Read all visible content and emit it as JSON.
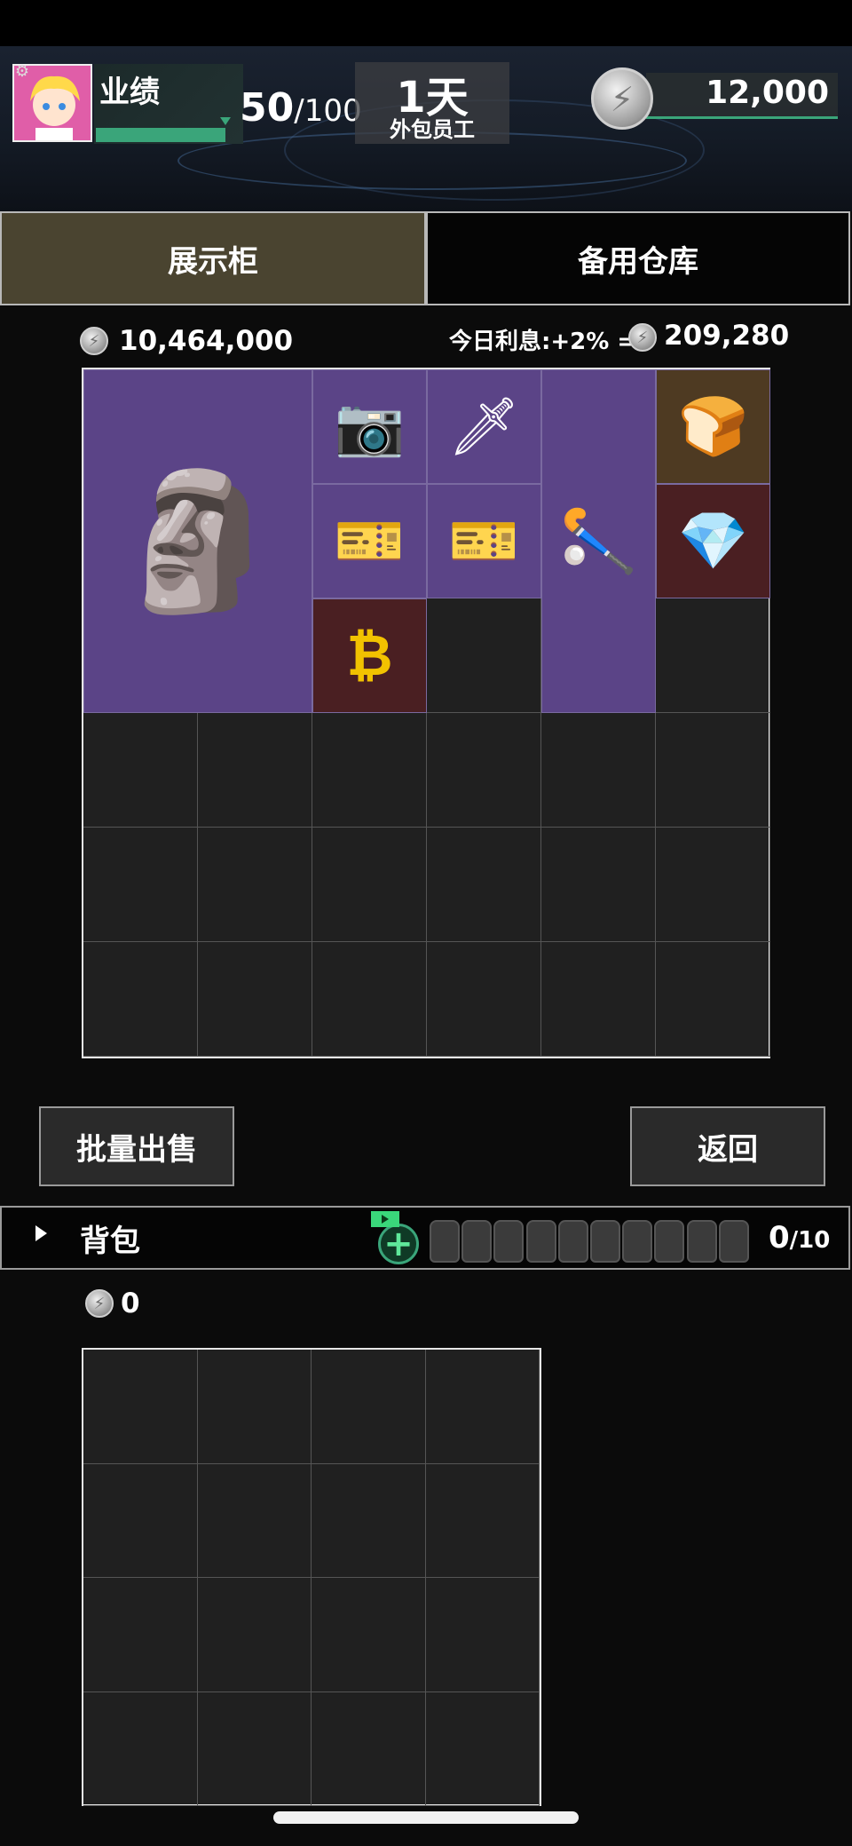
{
  "hud": {
    "performance_label": "业绩",
    "performance_current": "50",
    "performance_max": "/100",
    "performance_progress": 0.5,
    "day_count": "1天",
    "employee_type": "外包员工",
    "money": "12,000",
    "icons": [
      "gear-icon",
      "avatar",
      "coin-icon"
    ]
  },
  "tabs": [
    {
      "label": "展示柜",
      "active": true
    },
    {
      "label": "备用仓库",
      "active": false
    }
  ],
  "showcase": {
    "total_value": "10,464,000",
    "interest_label": "今日利息:+2% =",
    "interest_value": "209,280",
    "grid_cols": 6,
    "grid_rows": 6,
    "items": [
      {
        "name": "terracotta-warrior-rifle",
        "icon": "🗿",
        "bg": "purple"
      },
      {
        "name": "camera-scope",
        "icon": "📷",
        "bg": "purple"
      },
      {
        "name": "sword-keychain",
        "icon": "🗡",
        "bg": "purple"
      },
      {
        "name": "golden-staff",
        "icon": "🏑",
        "bg": "purple"
      },
      {
        "name": "gold-bread",
        "icon": "🍞",
        "bg": "brown"
      },
      {
        "name": "music-card-1",
        "icon": "🎫",
        "bg": "purple"
      },
      {
        "name": "music-card-2",
        "icon": "🎫",
        "bg": "purple"
      },
      {
        "name": "rainbow-crystal",
        "icon": "💎",
        "bg": "red"
      },
      {
        "name": "bitcoin",
        "icon": "₿",
        "bg": "red"
      }
    ]
  },
  "buttons": {
    "bulk_sell": "批量出售",
    "back": "返回"
  },
  "backpack": {
    "label": "背包",
    "count": "0",
    "count_max": "/10",
    "value": "0",
    "slots_total": 10,
    "grid_cols": 4,
    "grid_rows": 4
  },
  "colors": {
    "accent_green": "#3aa57a",
    "item_purple": "#5b4487",
    "item_red": "#4a1f22",
    "item_brown": "#4e3a22",
    "tab_active": "#4a4430"
  }
}
